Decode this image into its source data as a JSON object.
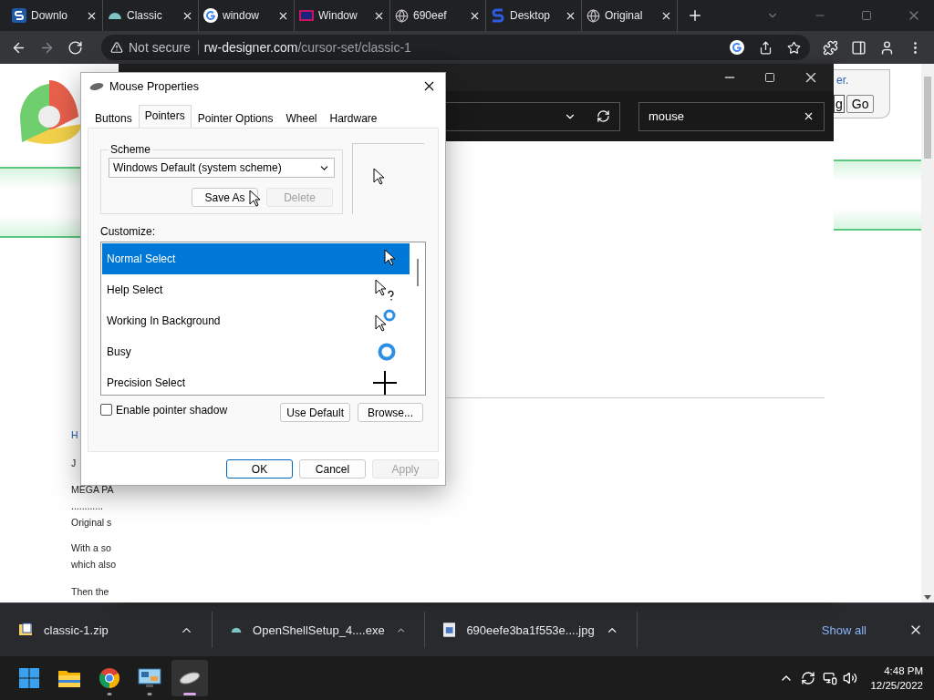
{
  "browser": {
    "tabs": [
      {
        "title": "Downlo",
        "kind": "s-logo"
      },
      {
        "title": "Classic",
        "kind": "shell"
      },
      {
        "title": "window",
        "kind": "g-logo"
      },
      {
        "title": "Window",
        "kind": "screen"
      },
      {
        "title": "690eef",
        "kind": "globe"
      },
      {
        "title": "Desktop",
        "kind": "s-blue"
      },
      {
        "title": "Original",
        "kind": "globe"
      }
    ],
    "security": "Not secure",
    "url_host": "rw-designer.com",
    "url_path": "/cursor-set/classic-1"
  },
  "page": {
    "left_texts": [
      {
        "text": "H",
        "kind": "link"
      },
      {
        "text": "J",
        "kind": "para"
      },
      {
        "text": "MEGA PA",
        "kind": "line"
      },
      {
        "text": "............",
        "kind": "line"
      },
      {
        "text": "Original s",
        "kind": "para"
      },
      {
        "text": "With a so",
        "kind": "line"
      },
      {
        "text": "which also",
        "kind": "para"
      },
      {
        "text": "Then the",
        "kind": "para"
      }
    ],
    "right_link": "er.",
    "search_value": "g",
    "go_button": "Go"
  },
  "explorer": {
    "search_value": "mouse"
  },
  "dialog": {
    "title": "Mouse Properties",
    "tabs": [
      {
        "label": "Buttons",
        "selected": false
      },
      {
        "label": "Pointers",
        "selected": true
      },
      {
        "label": "Pointer Options",
        "selected": false
      },
      {
        "label": "Wheel",
        "selected": false
      },
      {
        "label": "Hardware",
        "selected": false
      }
    ],
    "scheme_label": "Scheme",
    "scheme_value": "Windows Default (system scheme)",
    "scheme_buttons": [
      {
        "label": "Save As",
        "disabled": false
      },
      {
        "label": "Delete",
        "disabled": true
      }
    ],
    "customize_label": "Customize:",
    "pointers": [
      {
        "name": "Normal Select",
        "kind": "arrow",
        "selected": true
      },
      {
        "name": "Help Select",
        "kind": "help",
        "selected": false
      },
      {
        "name": "Working In Background",
        "kind": "working",
        "selected": false
      },
      {
        "name": "Busy",
        "kind": "busy",
        "selected": false
      },
      {
        "name": "Precision Select",
        "kind": "cross",
        "selected": false
      }
    ],
    "shadow": {
      "label": "Enable pointer shadow",
      "checked": false
    },
    "list_buttons": [
      {
        "label": "Use Default",
        "disabled": false
      },
      {
        "label": "Browse...",
        "disabled": false
      }
    ],
    "footer_buttons": [
      {
        "label": "OK",
        "default": true,
        "disabled": false
      },
      {
        "label": "Cancel",
        "default": false,
        "disabled": false
      },
      {
        "label": "Apply",
        "default": false,
        "disabled": true
      }
    ]
  },
  "downloads": {
    "items": [
      {
        "name": "classic-1.zip",
        "kind": "zip"
      },
      {
        "name": "OpenShellSetup_4....exe",
        "kind": "shell"
      },
      {
        "name": "690eefe3ba1f553e....jpg",
        "kind": "image"
      }
    ],
    "show_all": "Show all"
  },
  "taskbar": {
    "apps": [
      {
        "kind": "start",
        "running": false,
        "active": false
      },
      {
        "kind": "folder",
        "running": false,
        "active": false
      },
      {
        "kind": "chrome",
        "running": true,
        "active": false
      },
      {
        "kind": "panel",
        "running": true,
        "active": false
      },
      {
        "kind": "mouse",
        "running": true,
        "active": true
      }
    ],
    "time": "4:48 PM",
    "date": "12/25/2022"
  }
}
